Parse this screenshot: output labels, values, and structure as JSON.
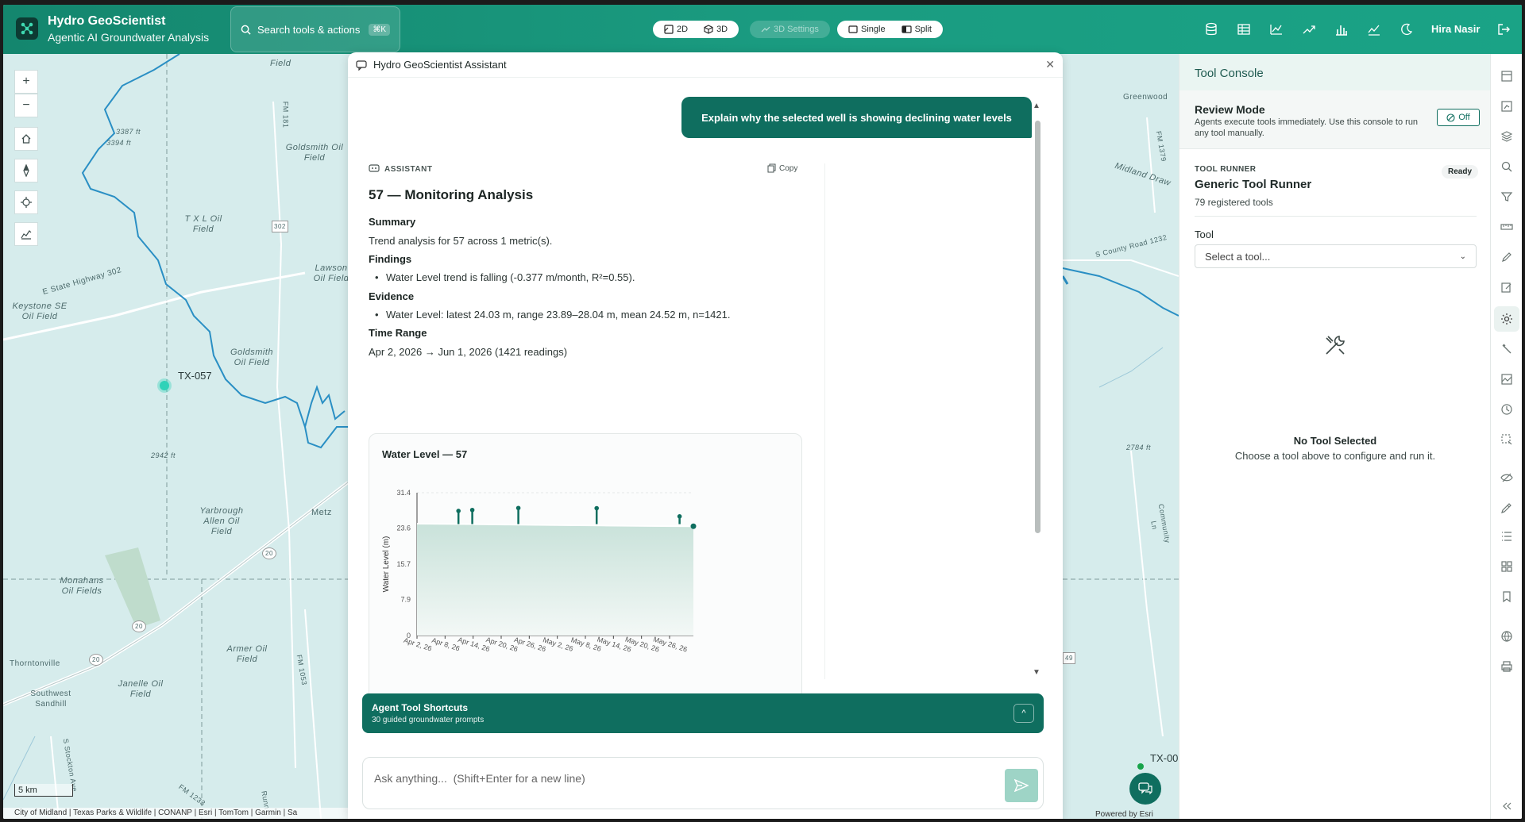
{
  "header": {
    "app_title": "Hydro GeoScientist",
    "app_subtitle": "Agentic AI Groundwater Analysis",
    "search_label": "Search tools & actions",
    "search_shortcut": "⌘K",
    "view_2d": "2D",
    "view_3d": "3D",
    "settings_3d": "3D Settings",
    "mode_single": "Single",
    "mode_split": "Split",
    "user_name": "Hira Nasir"
  },
  "map": {
    "labels": [
      "Field",
      "Goldsmith Oil Field",
      "T X L Oil Field",
      "Lawson Oil Field",
      "Keystone SE Oil Field",
      "Goldsmith Oil Field",
      "Yarbrough Allen Oil Field",
      "Metz",
      "Monahans Oil Fields",
      "Armer Oil Field",
      "Janelle Oil Field",
      "Thorntonville",
      "Southwest Sandhill",
      "Greenwood",
      "Midland Draw"
    ],
    "roads": [
      "E State Highway 302",
      "FM 181",
      "S County Road 1232",
      "FM 1379",
      "FM 1053",
      "Community Ln",
      "S Stockton Ave",
      "FM 1233",
      "Runn"
    ],
    "shields": [
      "302",
      "20",
      "20",
      "20",
      "49"
    ],
    "elevations": [
      "3387 ft",
      "3394 ft",
      "2942 ft",
      "2784 ft"
    ],
    "well_label": "TX-057",
    "well_label_2": "TX-00",
    "scale": "5 km",
    "attribution": "City of Midland | Texas Parks & Wildlife | CONANP | Esri | TomTom | Garmin | Sa",
    "powered_by": "Powered by Esri"
  },
  "assistant": {
    "title": "Hydro GeoScientist Assistant",
    "user_message": "Explain why the selected well is showing declining water levels",
    "role_label": "ASSISTANT",
    "copy_label": "Copy",
    "analysis_title": "57 — Monitoring Analysis",
    "summary_h": "Summary",
    "summary_t": "Trend analysis for 57 across 1 metric(s).",
    "findings_h": "Findings",
    "findings_1": "Water Level trend is falling (-0.377 m/month, R²=0.55).",
    "evidence_h": "Evidence",
    "evidence_1": "Water Level: latest 24.03 m, range 23.89–28.04 m, mean 24.52 m, n=1421.",
    "time_h": "Time Range",
    "time_t": "Apr 2, 2026 → Jun 1, 2026 (1421 readings)",
    "shortcuts_title": "Agent Tool Shortcuts",
    "shortcuts_sub": "30 guided groundwater prompts",
    "input_placeholder": "Ask anything...  (Shift+Enter for a new line)"
  },
  "chart_data": {
    "type": "area",
    "title": "Water Level — 57",
    "ylabel": "Water Level (m)",
    "xlabel": "",
    "ylim": [
      0,
      31.4
    ],
    "yticks": [
      0,
      7.9,
      15.7,
      23.6,
      31.4
    ],
    "ytick_labels": [
      "0",
      "7.9",
      "15.7",
      "23.6",
      "31.4"
    ],
    "xticks": [
      "Apr 2, 26",
      "Apr 8, 26",
      "Apr 14, 26",
      "Apr 20, 26",
      "Apr 26, 26",
      "May 2, 26",
      "May 8, 26",
      "May 14, 26",
      "May 20, 26",
      "May 26, 26"
    ],
    "x_start": "2026-04-02",
    "x_end": "2026-06-01",
    "series": [
      {
        "values_x": [
          "2026-04-02",
          "2026-04-12",
          "2026-04-22",
          "2026-05-02",
          "2026-05-12",
          "2026-05-22",
          "2026-06-01"
        ],
        "values_y": [
          24.6,
          24.5,
          24.4,
          24.3,
          24.2,
          24.1,
          24.03
        ]
      }
    ],
    "spikes": [
      {
        "x": "2026-04-11",
        "y": 27.4
      },
      {
        "x": "2026-04-14",
        "y": 27.6
      },
      {
        "x": "2026-04-24",
        "y": 28.04
      },
      {
        "x": "2026-05-11",
        "y": 28.0
      },
      {
        "x": "2026-05-29",
        "y": 26.2
      }
    ],
    "last_point": {
      "x": "2026-06-01",
      "y": 24.03
    },
    "colors": {
      "line": "#0f6e5f",
      "fill_top": "#c9e2da",
      "fill_bottom": "#f3f8f6"
    }
  },
  "console": {
    "title": "Tool Console",
    "review_h": "Review Mode",
    "review_p": "Agents execute tools immediately. Use this console to run any tool manually.",
    "review_btn": "Off",
    "runner_kicker": "TOOL RUNNER",
    "runner_name": "Generic Tool Runner",
    "runner_count": "79 registered tools",
    "ready": "Ready",
    "tool_label": "Tool",
    "select_placeholder": "Select a tool...",
    "empty_h": "No Tool Selected",
    "empty_p": "Choose a tool above to configure and run it."
  },
  "colors": {
    "brand": "#1a9b80",
    "brand_dark": "#0f6e5f",
    "map_bg": "#d6ecec",
    "water": "#2a8fc4"
  }
}
